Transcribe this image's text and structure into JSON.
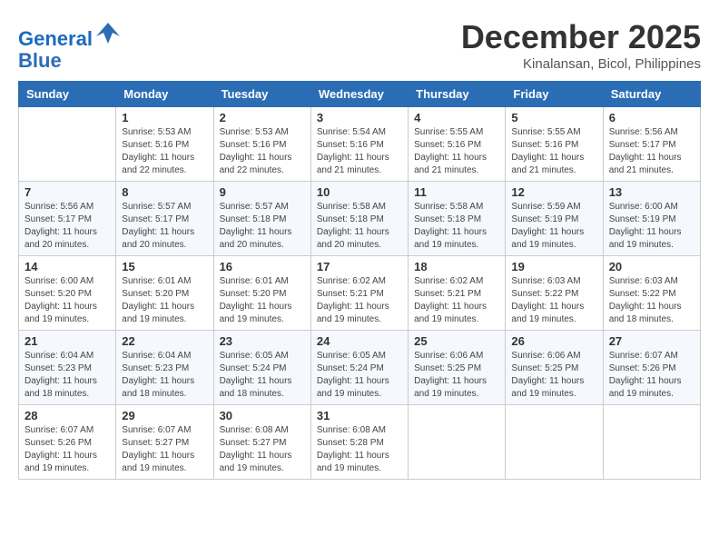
{
  "logo": {
    "line1": "General",
    "line2": "Blue"
  },
  "title": "December 2025",
  "subtitle": "Kinalansan, Bicol, Philippines",
  "days_of_week": [
    "Sunday",
    "Monday",
    "Tuesday",
    "Wednesday",
    "Thursday",
    "Friday",
    "Saturday"
  ],
  "weeks": [
    [
      {
        "day": "",
        "info": ""
      },
      {
        "day": "1",
        "info": "Sunrise: 5:53 AM\nSunset: 5:16 PM\nDaylight: 11 hours\nand 22 minutes."
      },
      {
        "day": "2",
        "info": "Sunrise: 5:53 AM\nSunset: 5:16 PM\nDaylight: 11 hours\nand 22 minutes."
      },
      {
        "day": "3",
        "info": "Sunrise: 5:54 AM\nSunset: 5:16 PM\nDaylight: 11 hours\nand 21 minutes."
      },
      {
        "day": "4",
        "info": "Sunrise: 5:55 AM\nSunset: 5:16 PM\nDaylight: 11 hours\nand 21 minutes."
      },
      {
        "day": "5",
        "info": "Sunrise: 5:55 AM\nSunset: 5:16 PM\nDaylight: 11 hours\nand 21 minutes."
      },
      {
        "day": "6",
        "info": "Sunrise: 5:56 AM\nSunset: 5:17 PM\nDaylight: 11 hours\nand 21 minutes."
      }
    ],
    [
      {
        "day": "7",
        "info": "Sunrise: 5:56 AM\nSunset: 5:17 PM\nDaylight: 11 hours\nand 20 minutes."
      },
      {
        "day": "8",
        "info": "Sunrise: 5:57 AM\nSunset: 5:17 PM\nDaylight: 11 hours\nand 20 minutes."
      },
      {
        "day": "9",
        "info": "Sunrise: 5:57 AM\nSunset: 5:18 PM\nDaylight: 11 hours\nand 20 minutes."
      },
      {
        "day": "10",
        "info": "Sunrise: 5:58 AM\nSunset: 5:18 PM\nDaylight: 11 hours\nand 20 minutes."
      },
      {
        "day": "11",
        "info": "Sunrise: 5:58 AM\nSunset: 5:18 PM\nDaylight: 11 hours\nand 19 minutes."
      },
      {
        "day": "12",
        "info": "Sunrise: 5:59 AM\nSunset: 5:19 PM\nDaylight: 11 hours\nand 19 minutes."
      },
      {
        "day": "13",
        "info": "Sunrise: 6:00 AM\nSunset: 5:19 PM\nDaylight: 11 hours\nand 19 minutes."
      }
    ],
    [
      {
        "day": "14",
        "info": "Sunrise: 6:00 AM\nSunset: 5:20 PM\nDaylight: 11 hours\nand 19 minutes."
      },
      {
        "day": "15",
        "info": "Sunrise: 6:01 AM\nSunset: 5:20 PM\nDaylight: 11 hours\nand 19 minutes."
      },
      {
        "day": "16",
        "info": "Sunrise: 6:01 AM\nSunset: 5:20 PM\nDaylight: 11 hours\nand 19 minutes."
      },
      {
        "day": "17",
        "info": "Sunrise: 6:02 AM\nSunset: 5:21 PM\nDaylight: 11 hours\nand 19 minutes."
      },
      {
        "day": "18",
        "info": "Sunrise: 6:02 AM\nSunset: 5:21 PM\nDaylight: 11 hours\nand 19 minutes."
      },
      {
        "day": "19",
        "info": "Sunrise: 6:03 AM\nSunset: 5:22 PM\nDaylight: 11 hours\nand 19 minutes."
      },
      {
        "day": "20",
        "info": "Sunrise: 6:03 AM\nSunset: 5:22 PM\nDaylight: 11 hours\nand 18 minutes."
      }
    ],
    [
      {
        "day": "21",
        "info": "Sunrise: 6:04 AM\nSunset: 5:23 PM\nDaylight: 11 hours\nand 18 minutes."
      },
      {
        "day": "22",
        "info": "Sunrise: 6:04 AM\nSunset: 5:23 PM\nDaylight: 11 hours\nand 18 minutes."
      },
      {
        "day": "23",
        "info": "Sunrise: 6:05 AM\nSunset: 5:24 PM\nDaylight: 11 hours\nand 18 minutes."
      },
      {
        "day": "24",
        "info": "Sunrise: 6:05 AM\nSunset: 5:24 PM\nDaylight: 11 hours\nand 19 minutes."
      },
      {
        "day": "25",
        "info": "Sunrise: 6:06 AM\nSunset: 5:25 PM\nDaylight: 11 hours\nand 19 minutes."
      },
      {
        "day": "26",
        "info": "Sunrise: 6:06 AM\nSunset: 5:25 PM\nDaylight: 11 hours\nand 19 minutes."
      },
      {
        "day": "27",
        "info": "Sunrise: 6:07 AM\nSunset: 5:26 PM\nDaylight: 11 hours\nand 19 minutes."
      }
    ],
    [
      {
        "day": "28",
        "info": "Sunrise: 6:07 AM\nSunset: 5:26 PM\nDaylight: 11 hours\nand 19 minutes."
      },
      {
        "day": "29",
        "info": "Sunrise: 6:07 AM\nSunset: 5:27 PM\nDaylight: 11 hours\nand 19 minutes."
      },
      {
        "day": "30",
        "info": "Sunrise: 6:08 AM\nSunset: 5:27 PM\nDaylight: 11 hours\nand 19 minutes."
      },
      {
        "day": "31",
        "info": "Sunrise: 6:08 AM\nSunset: 5:28 PM\nDaylight: 11 hours\nand 19 minutes."
      },
      {
        "day": "",
        "info": ""
      },
      {
        "day": "",
        "info": ""
      },
      {
        "day": "",
        "info": ""
      }
    ]
  ]
}
